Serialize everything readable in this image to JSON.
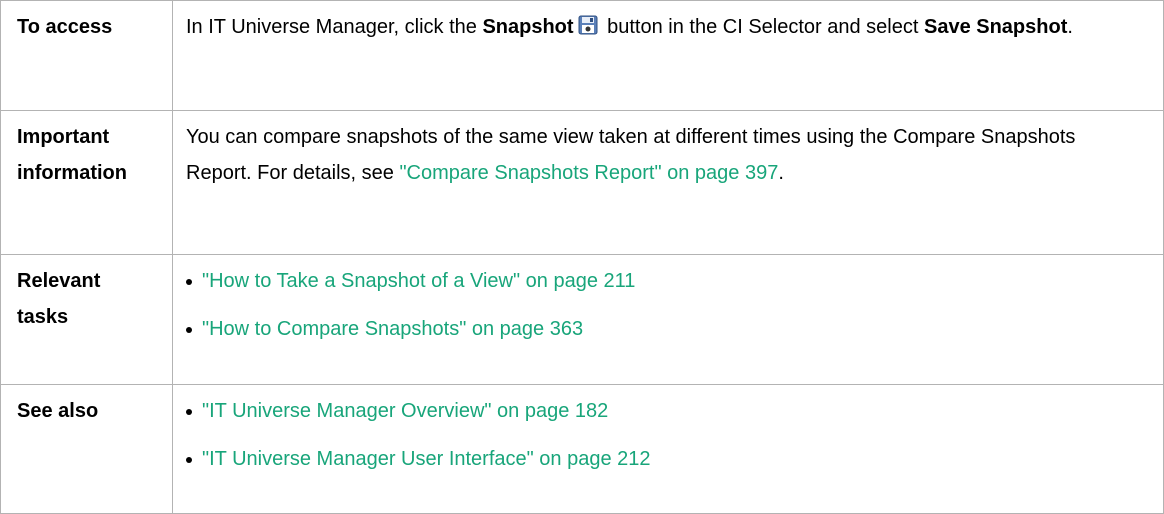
{
  "rows": [
    {
      "label": "To access",
      "text_1": "In IT Universe Manager, click the ",
      "bold_1": "Snapshot",
      "icon": "snapshot-save-icon",
      "text_2": " button in the CI Selector and select ",
      "bold_2": "Save Snapshot",
      "text_3": "."
    },
    {
      "label": "Important information",
      "label_line1": "Important",
      "label_line2": "information",
      "text_1": "You can compare snapshots of the same view taken at different times using the Compare Snapshots Report. For details, see ",
      "link": "\"Compare Snapshots Report\" on page 397",
      "text_2": "."
    },
    {
      "label": "Relevant tasks",
      "label_line1": "Relevant",
      "label_line2": "tasks",
      "items": [
        "\"How to Take a Snapshot of a View\" on page 211",
        "\"How to Compare Snapshots\" on page 363"
      ]
    },
    {
      "label": "See also",
      "items": [
        "\"IT Universe Manager Overview\" on page 182",
        "\"IT Universe Manager User Interface\" on page 212"
      ]
    }
  ],
  "colors": {
    "link": "#18a57a",
    "border": "#b3b3b3"
  }
}
